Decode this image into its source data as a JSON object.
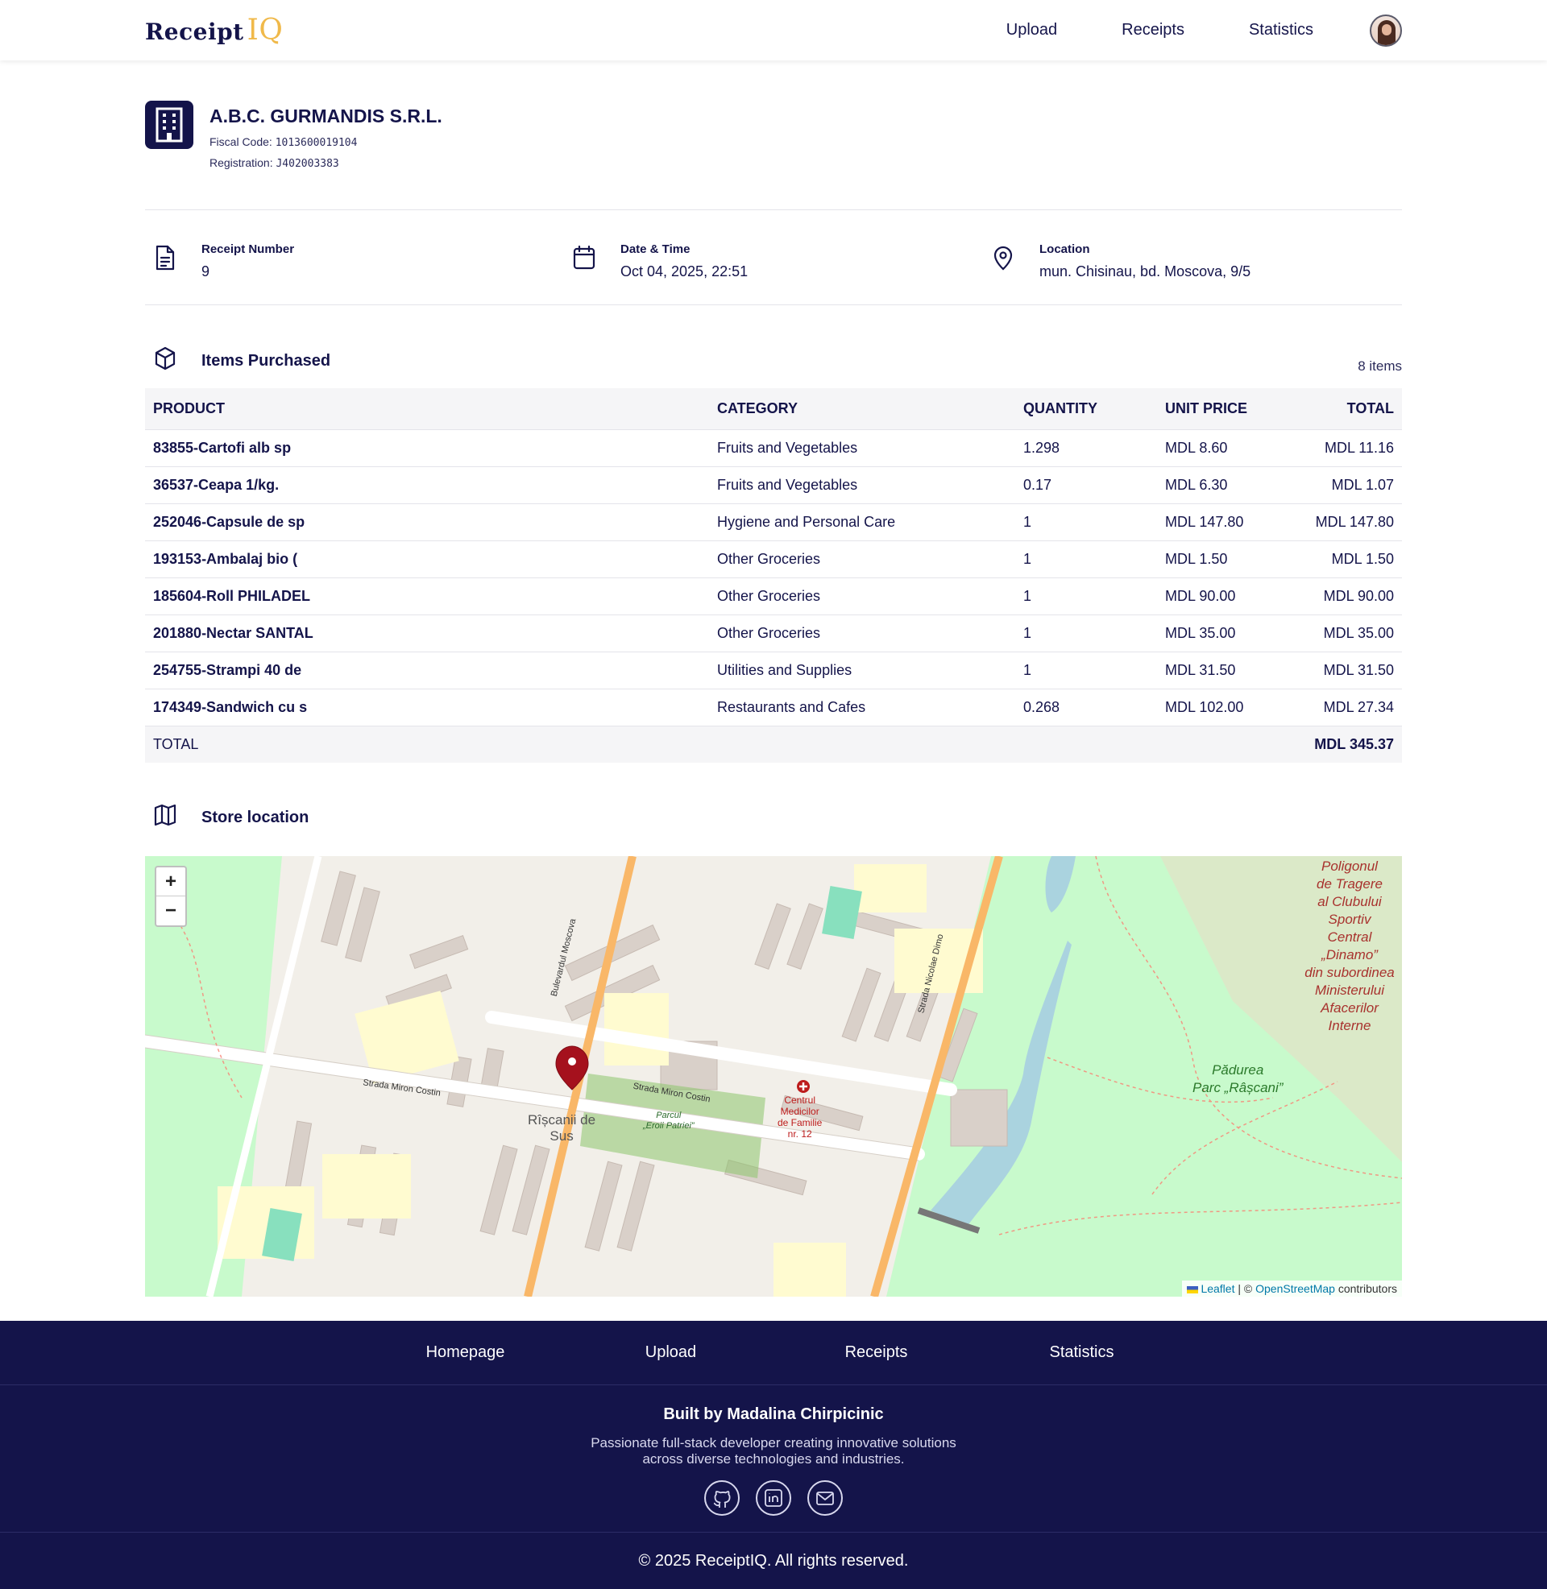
{
  "header": {
    "logo_part1": "Receipt",
    "logo_part2": "IQ",
    "nav": [
      {
        "label": "Upload"
      },
      {
        "label": "Receipts"
      },
      {
        "label": "Statistics"
      }
    ]
  },
  "store": {
    "name": "A.B.C. GURMANDIS S.R.L.",
    "fiscal_label": "Fiscal Code:",
    "fiscal_code": "1013600019104",
    "registration_label": "Registration:",
    "registration": "J402003383"
  },
  "info": {
    "receipt_number_label": "Receipt Number",
    "receipt_number": "9",
    "datetime_label": "Date & Time",
    "datetime": "Oct 04, 2025, 22:51",
    "location_label": "Location",
    "location": "mun. Chisinau, bd. Moscova, 9/5"
  },
  "items": {
    "title": "Items Purchased",
    "count": "8 items",
    "columns": [
      "PRODUCT",
      "CATEGORY",
      "QUANTITY",
      "UNIT PRICE",
      "TOTAL"
    ],
    "rows": [
      {
        "product": "83855-Cartofi alb sp",
        "category": "Fruits and Vegetables",
        "quantity": "1.298",
        "unit_price": "MDL 8.60",
        "total": "MDL 11.16"
      },
      {
        "product": "36537-Ceapa 1/kg.",
        "category": "Fruits and Vegetables",
        "quantity": "0.17",
        "unit_price": "MDL 6.30",
        "total": "MDL 1.07"
      },
      {
        "product": "252046-Capsule de sp",
        "category": "Hygiene and Personal Care",
        "quantity": "1",
        "unit_price": "MDL 147.80",
        "total": "MDL 147.80"
      },
      {
        "product": "193153-Ambalaj bio (",
        "category": "Other Groceries",
        "quantity": "1",
        "unit_price": "MDL 1.50",
        "total": "MDL 1.50"
      },
      {
        "product": "185604-Roll PHILADEL",
        "category": "Other Groceries",
        "quantity": "1",
        "unit_price": "MDL 90.00",
        "total": "MDL 90.00"
      },
      {
        "product": "201880-Nectar SANTAL",
        "category": "Other Groceries",
        "quantity": "1",
        "unit_price": "MDL 35.00",
        "total": "MDL 35.00"
      },
      {
        "product": "254755-Strampi 40 de",
        "category": "Utilities and Supplies",
        "quantity": "1",
        "unit_price": "MDL 31.50",
        "total": "MDL 31.50"
      },
      {
        "product": "174349-Sandwich cu s",
        "category": "Restaurants and Cafes",
        "quantity": "0.268",
        "unit_price": "MDL 102.00",
        "total": "MDL 27.34"
      }
    ],
    "total_label": "TOTAL",
    "total_value": "MDL 345.37"
  },
  "map": {
    "title": "Store location",
    "zoom_in": "+",
    "zoom_out": "−",
    "attribution_leaflet": "Leaflet",
    "attribution_sep": " | © ",
    "attribution_osm": "OpenStreetMap",
    "attribution_contrib": " contributors",
    "labels": {
      "district1": "Rîșcanii de",
      "district2": "Sus",
      "park_label1": "Pădurea",
      "park_label2": "Parc „Râșcani”",
      "street1": "Strada Miron Costin",
      "street2": "Bulevardul Moscova",
      "street3": "Strada Nicolae Dimo",
      "medical1": "Centrul",
      "medical2": "Medicilor",
      "medical3": "de Familie",
      "medical4": "nr. 12",
      "park2a": "Parcul",
      "park2b": "„Eroii Patriei”",
      "military": [
        "Poligonul",
        "de Tragere",
        "al Clubului",
        "Sportiv",
        "Central",
        "„Dinamo”",
        "din subordinea",
        "Ministerului",
        "Afacerilor",
        "Interne"
      ]
    }
  },
  "footer": {
    "nav": [
      {
        "label": "Homepage"
      },
      {
        "label": "Upload"
      },
      {
        "label": "Receipts"
      },
      {
        "label": "Statistics"
      }
    ],
    "built_by": "Built by Madalina Chirpicinic",
    "description": "Passionate full-stack developer creating innovative solutions across diverse technologies and industries.",
    "copyright": "© 2025 ReceiptIQ. All rights reserved."
  },
  "colors": {
    "navy": "#14144a",
    "logo_accent": "#f0b94a",
    "pin": "#a5111d",
    "park": "#c8facc",
    "road_major": "#f9b768"
  }
}
